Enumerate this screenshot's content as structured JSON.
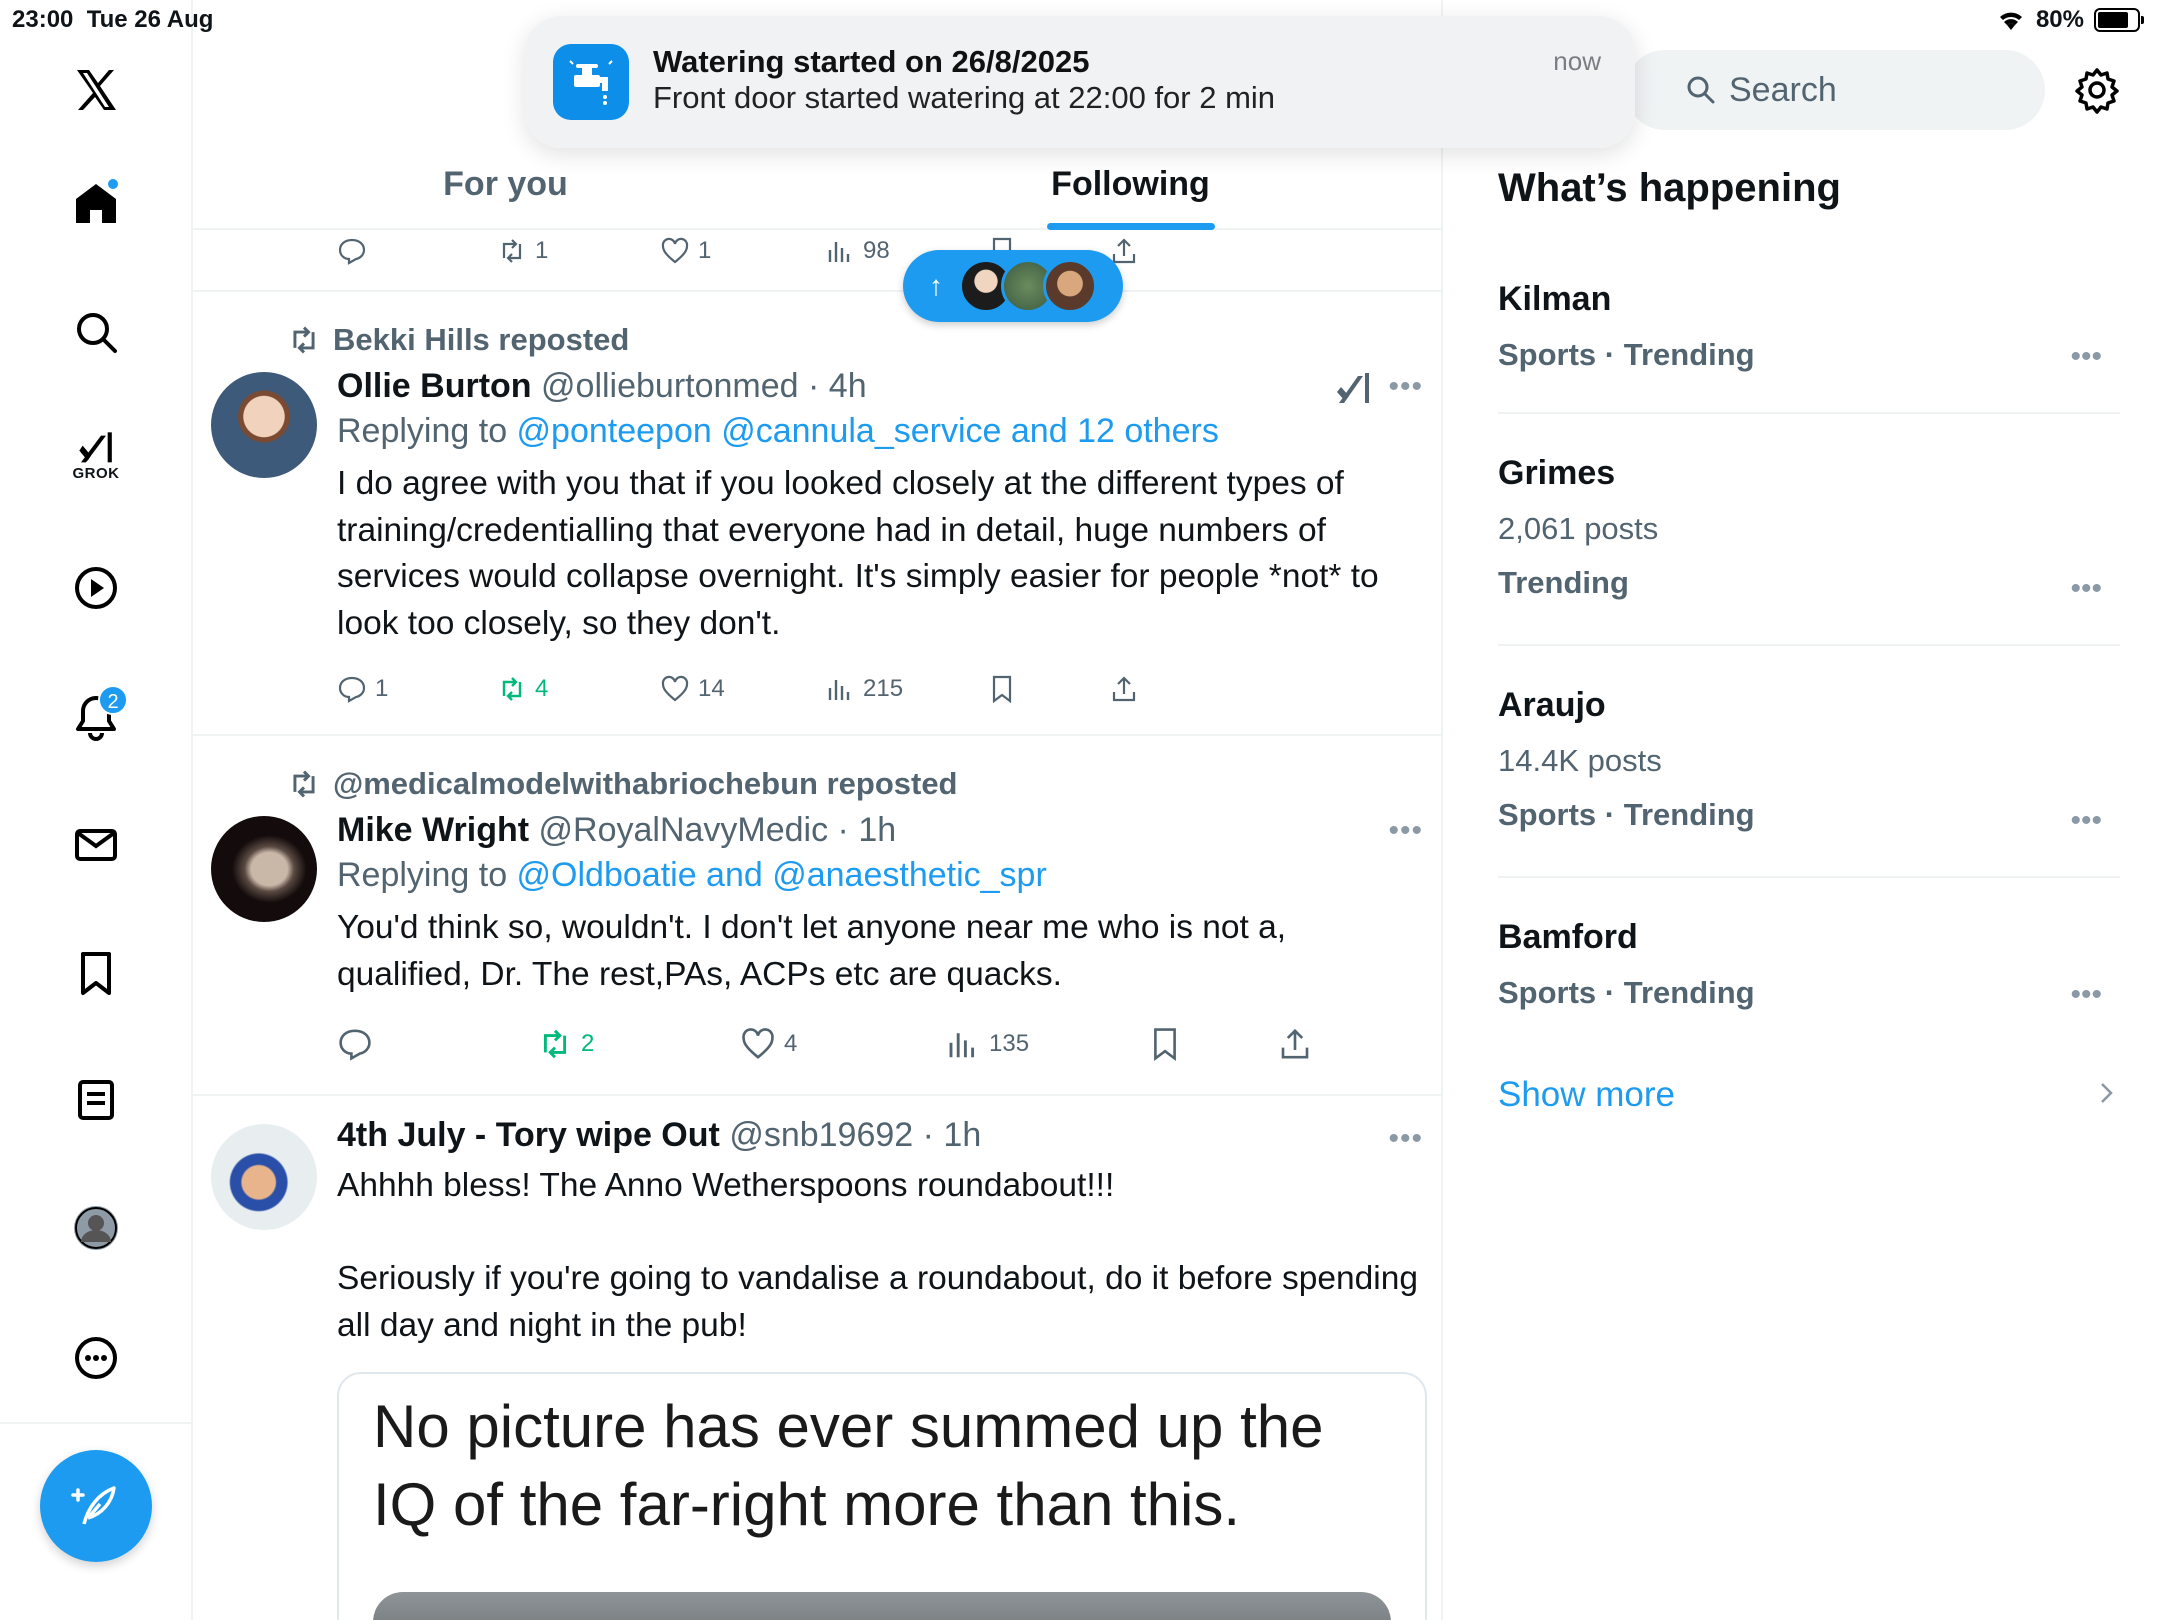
{
  "status_bar": {
    "time": "23:00",
    "date": "Tue 26 Aug",
    "battery": "80%",
    "battery_level": 0.8
  },
  "notification": {
    "app_icon": "watering-tap-icon",
    "title": "Watering started on 26/8/2025",
    "body": "Front door started watering at 22:00 for 2 min",
    "time": "now"
  },
  "rail": {
    "items": [
      {
        "name": "x-logo-icon"
      },
      {
        "name": "home-icon"
      },
      {
        "name": "search-icon"
      },
      {
        "name": "grok-icon",
        "label": "GROK"
      },
      {
        "name": "video-icon"
      },
      {
        "name": "notifications-icon",
        "badge": "2"
      },
      {
        "name": "messages-icon"
      },
      {
        "name": "bookmarks-icon"
      },
      {
        "name": "lists-icon"
      },
      {
        "name": "profile-icon"
      },
      {
        "name": "more-icon"
      }
    ],
    "notifications_badge": "2"
  },
  "tabs": [
    {
      "label": "For you",
      "active": false
    },
    {
      "label": "Following",
      "active": true
    }
  ],
  "partial_tweet": {
    "retweets": "1",
    "likes": "1",
    "views": "98"
  },
  "tweets": [
    {
      "reposted_by": "Bekki Hills reposted",
      "name": "Ollie Burton",
      "handle": "@ollieburtonmed",
      "time": "4h",
      "replying_prefix": "Replying to ",
      "replying_to": "@ponteepon @cannula_service and 12 others",
      "text": "I do agree with you that if you looked closely at the different types of training/credentialling that everyone had in detail, huge numbers of services would collapse overnight. It's simply easier for people *not* to look too closely, so they don't.",
      "replies": "1",
      "retweets": "4",
      "likes": "14",
      "views": "215"
    },
    {
      "reposted_by": "@medicalmodelwithabriochebun reposted",
      "name": "Mike Wright",
      "handle": "@RoyalNavyMedic",
      "time": "1h",
      "replying_prefix": "Replying to ",
      "replying_to": "@Oldboatie and @anaesthetic_spr",
      "text": "You'd think so, wouldn't. I don't let anyone near me who is not a, qualified, Dr. The rest,PAs, ACPs etc are quacks.",
      "replies": "",
      "retweets": "2",
      "likes": "4",
      "views": "135"
    },
    {
      "name": "4th July - Tory wipe Out",
      "handle": "@snb19692",
      "time": "1h",
      "text": "Ahhhh bless! The Anno Wetherspoons roundabout!!!\n\nSeriously if you're going to vandalise a roundabout, do it before spending all day and night in the pub!",
      "media_text": "No picture has ever summed up the IQ of the far-right more than this."
    }
  ],
  "search": {
    "placeholder": "Search"
  },
  "whats_happening": {
    "title": "What’s happening",
    "trends": [
      {
        "name": "Kilman",
        "category": "Sports · Trending"
      },
      {
        "name": "Grimes",
        "posts": "2,061 posts",
        "category": "Trending"
      },
      {
        "name": "Araujo",
        "posts": "14.4K posts",
        "category": "Sports · Trending"
      },
      {
        "name": "Bamford",
        "category": "Sports · Trending"
      }
    ],
    "show_more": "Show more"
  },
  "colors": {
    "accent": "#1d9bf0",
    "repost_green": "#00ba7c",
    "muted": "#536471"
  }
}
